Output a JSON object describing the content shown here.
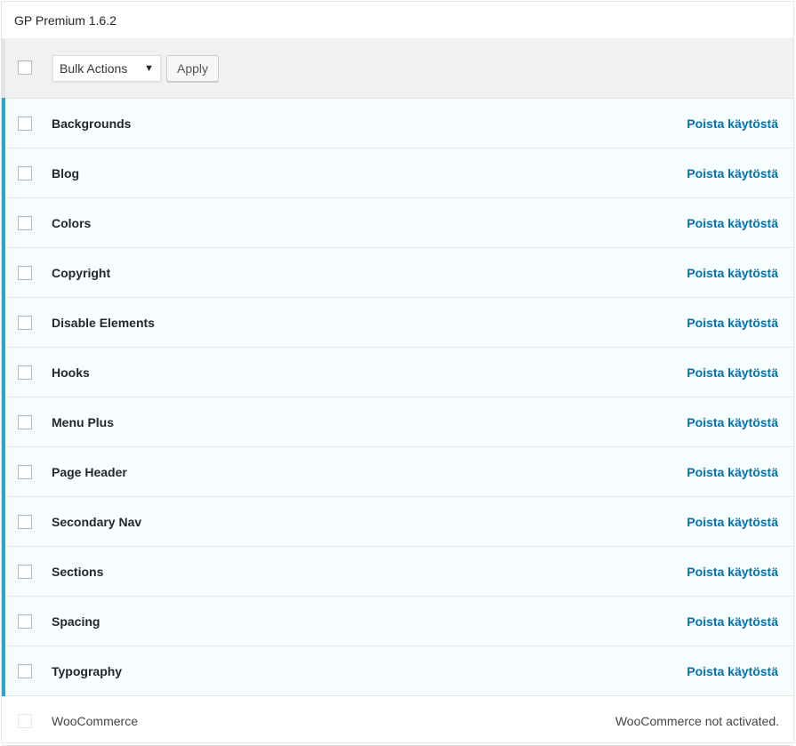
{
  "panel": {
    "title": "GP Premium 1.6.2"
  },
  "toolbar": {
    "bulk_actions": "Bulk Actions",
    "bulk_arrow": "▼",
    "apply_label": "Apply"
  },
  "modules": [
    {
      "name": "Backgrounds",
      "action": "Poista käytöstä"
    },
    {
      "name": "Blog",
      "action": "Poista käytöstä"
    },
    {
      "name": "Colors",
      "action": "Poista käytöstä"
    },
    {
      "name": "Copyright",
      "action": "Poista käytöstä"
    },
    {
      "name": "Disable Elements",
      "action": "Poista käytöstä"
    },
    {
      "name": "Hooks",
      "action": "Poista käytöstä"
    },
    {
      "name": "Menu Plus",
      "action": "Poista käytöstä"
    },
    {
      "name": "Page Header",
      "action": "Poista käytöstä"
    },
    {
      "name": "Secondary Nav",
      "action": "Poista käytöstä"
    },
    {
      "name": "Sections",
      "action": "Poista käytöstä"
    },
    {
      "name": "Spacing",
      "action": "Poista käytöstä"
    },
    {
      "name": "Typography",
      "action": "Poista käytöstä"
    }
  ],
  "inactive_module": {
    "name": "WooCommerce",
    "status": "WooCommerce not activated."
  },
  "colors": {
    "accent": "#2ea2cc",
    "link": "#0073aa",
    "active_bg": "#f7fcfe"
  }
}
